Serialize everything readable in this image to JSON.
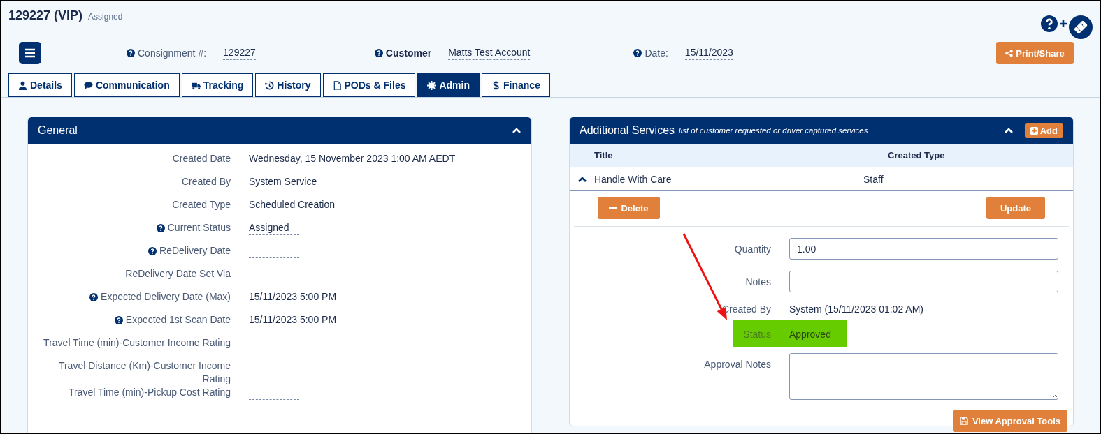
{
  "header": {
    "title": "129227 (VIP)",
    "status": "Assigned"
  },
  "summary": [
    {
      "label": "Consignment #:",
      "value": "129227",
      "help": true,
      "bold": false
    },
    {
      "label": "Customer",
      "value": "Matts Test Account",
      "help": true,
      "bold": true
    },
    {
      "label": "Date:",
      "value": "15/11/2023",
      "help": true,
      "bold": false
    }
  ],
  "print_button": "Print/Share",
  "tabs": [
    {
      "label": "Details",
      "selected": false
    },
    {
      "label": "Communication",
      "selected": false
    },
    {
      "label": "Tracking",
      "selected": false
    },
    {
      "label": "History",
      "selected": false
    },
    {
      "label": "PODs & Files",
      "selected": false
    },
    {
      "label": "Admin",
      "selected": true
    },
    {
      "label": "Finance",
      "selected": false
    }
  ],
  "general": {
    "title": "General",
    "expanded": true,
    "rows": [
      {
        "label": "Created Date",
        "value": "Wednesday, 15 November 2023 1:00 AM AEDT",
        "help": false,
        "editable": false
      },
      {
        "label": "Created By",
        "value": "System Service",
        "help": false,
        "editable": false
      },
      {
        "label": "Created Type",
        "value": "Scheduled Creation",
        "help": false,
        "editable": false
      },
      {
        "label": "Current Status",
        "value": "Assigned",
        "help": true,
        "editable": true
      },
      {
        "label": "ReDelivery Date",
        "help": true,
        "editable": true
      },
      {
        "label": "ReDelivery Date Set Via",
        "help": false,
        "editable": false
      },
      {
        "label": "Expected Delivery Date (Max)",
        "value": "15/11/2023 5:00 PM",
        "help": true,
        "editable": true
      },
      {
        "label": "Expected 1st Scan Date",
        "value": "15/11/2023 5:00 PM",
        "help": true,
        "editable": true
      },
      {
        "label": "Travel Time (min)-Customer Income Rating",
        "help": false,
        "editable": true
      },
      {
        "label": "Travel Distance (Km)-Customer Income Rating",
        "help": false,
        "editable": true
      },
      {
        "label": "Travel Time (min)-Pickup Cost Rating",
        "help": false,
        "editable": true
      }
    ]
  },
  "services": {
    "title": "Additional Services",
    "subtitle": "list of customer requested or driver captured services",
    "expanded": true,
    "add_button": "Add",
    "columns": [
      "Title",
      "Created Type"
    ],
    "rows": [
      {
        "title": "Handle With Care",
        "created_type": "Staff",
        "expanded": true
      }
    ],
    "delete_button": "Delete",
    "update_button": "Update",
    "fields": [
      {
        "kind": "input",
        "label": "Quantity",
        "value": "1.00",
        "highlighted": false
      },
      {
        "kind": "input",
        "label": "Notes",
        "highlighted": false
      },
      {
        "kind": "text",
        "label": "Created By",
        "value": "System (15/11/2023 01:02 AM)",
        "highlighted": false
      },
      {
        "kind": "text",
        "label": "Status",
        "value": "Approved",
        "highlighted": true
      },
      {
        "kind": "textarea",
        "label": "Approval Notes",
        "highlighted": false
      }
    ],
    "approval_button": "View Approval Tools"
  }
}
